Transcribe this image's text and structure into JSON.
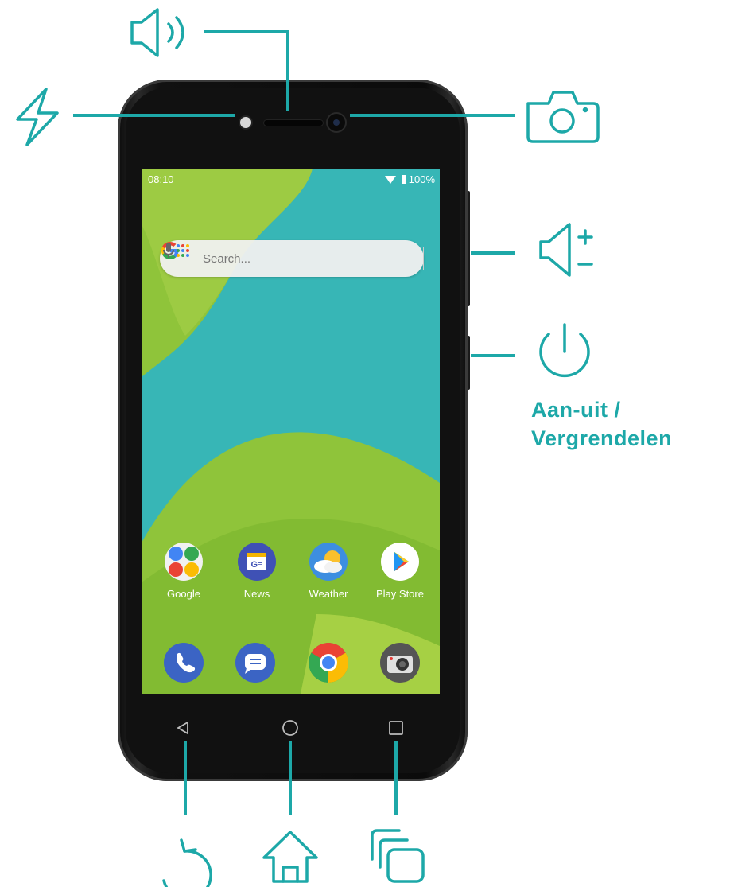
{
  "status_bar": {
    "time": "08:10",
    "battery": "100%"
  },
  "search": {
    "placeholder": "Search..."
  },
  "apps": [
    {
      "label": "Google"
    },
    {
      "label": "News"
    },
    {
      "label": "Weather"
    },
    {
      "label": "Play Store"
    }
  ],
  "dock": [
    "phone-icon",
    "messages-icon",
    "chrome-icon",
    "camera-icon"
  ],
  "nav_keys": [
    "back",
    "home",
    "recents"
  ],
  "callouts": {
    "power_label": [
      "Aan-uit /",
      "Vergrendelen"
    ]
  },
  "colors": {
    "accent": "#1da8a8",
    "wallpaper_teal": "#37b6b6",
    "wallpaper_green": "#8fc43a"
  }
}
